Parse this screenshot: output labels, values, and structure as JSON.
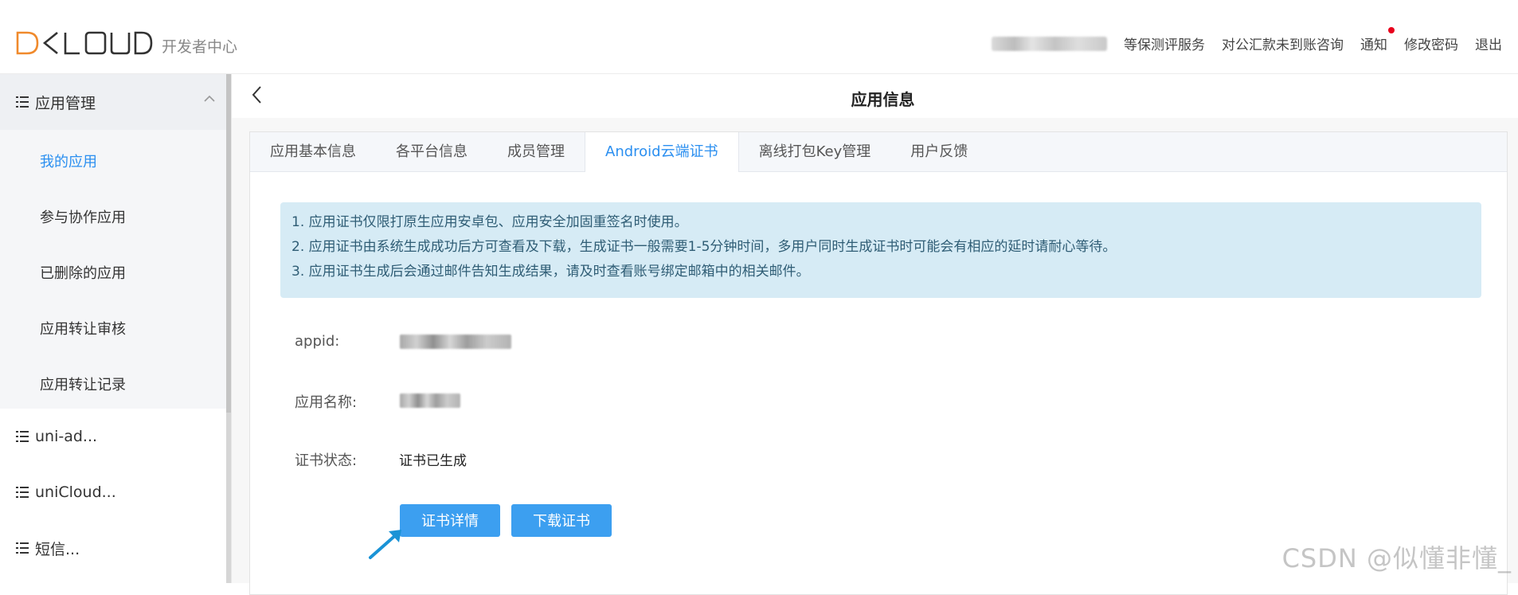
{
  "header": {
    "brand_sub": "开发者中心",
    "nav": {
      "service_1": "等保测评服务",
      "service_2": "对公汇款未到账咨询",
      "notice": "通知",
      "change_password": "修改密码",
      "logout": "退出"
    }
  },
  "sidebar": {
    "group_label": "应用管理",
    "sub_items": [
      "我的应用",
      "参与协作应用",
      "已删除的应用",
      "应用转让审核",
      "应用转让记录"
    ],
    "items": [
      "uni-ad...",
      "uniCloud...",
      "短信..."
    ]
  },
  "page": {
    "title": "应用信息",
    "tabs": [
      "应用基本信息",
      "各平台信息",
      "成员管理",
      "Android云端证书",
      "离线打包Key管理",
      "用户反馈"
    ],
    "active_tab": "Android云端证书",
    "alert_lines": [
      "1. 应用证书仅限打原生应用安卓包、应用安全加固重签名时使用。",
      "2. 应用证书由系统生成成功后方可查看及下载，生成证书一般需要1-5分钟时间，多用户同时生成证书时可能会有相应的延时请耐心等待。",
      "3. 应用证书生成后会通过邮件告知生成结果，请及时查看账号绑定邮箱中的相关邮件。"
    ],
    "fields": {
      "appid_label": "appid:",
      "name_label": "应用名称:",
      "status_label": "证书状态:",
      "status_value": "证书已生成"
    },
    "buttons": {
      "detail": "证书详情",
      "download": "下载证书"
    }
  },
  "watermark": "CSDN @似懂非懂_",
  "colors": {
    "accent": "#2b8ff0",
    "button": "#3c9ff0",
    "alert_bg": "#d6ebf5",
    "notice_dot": "#e8001c",
    "arrow": "#1a93d6"
  }
}
